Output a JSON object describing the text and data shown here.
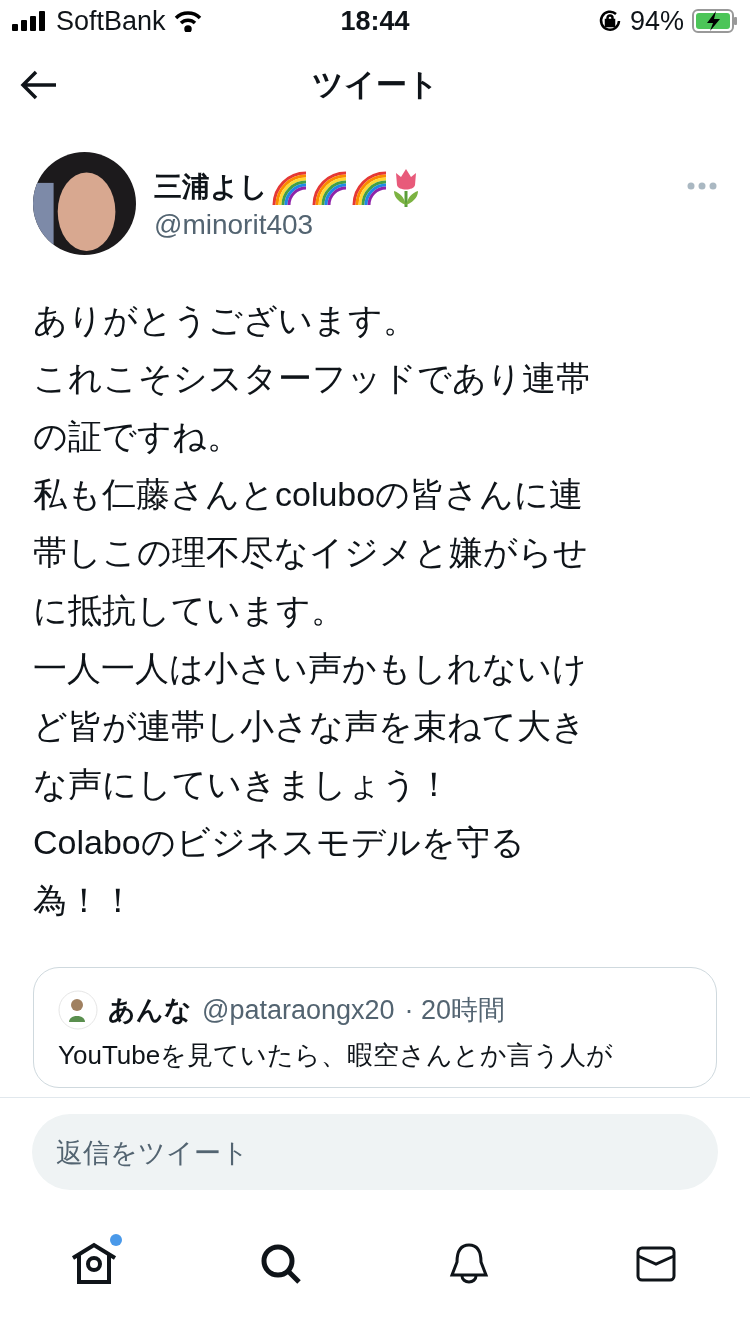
{
  "status_bar": {
    "carrier": "SoftBank",
    "time": "18:44",
    "battery": "94%"
  },
  "header": {
    "title": "ツイート"
  },
  "tweet": {
    "name": "三浦よし",
    "handle": "@minorit403",
    "lines": [
      "ありがとうございます。",
      "これこそシスターフッドであり連帯",
      "の証ですね。",
      "私も仁藤さんとcoluboの皆さんに連",
      "帯しこの理不尽なイジメと嫌がらせ",
      "に抵抗しています。",
      "一人一人は小さい声かもしれないけ",
      "ど皆が連帯し小さな声を束ねて大き",
      "な声にしていきましょう！",
      "Colaboのビジネスモデルを守る",
      "為！！"
    ],
    "quote": {
      "name": "あんな",
      "handle": "@pataraongx20",
      "time": "· 20時間",
      "text": "YouTubeを見ていたら、暇空さんとか言う人が"
    }
  },
  "reply": {
    "placeholder": "返信をツイート"
  },
  "tab_bar": [
    {
      "kind": "home",
      "selected": true,
      "badge": true
    },
    {
      "kind": "search",
      "selected": false,
      "badge": false
    },
    {
      "kind": "notifications",
      "selected": false,
      "badge": false
    },
    {
      "kind": "messages",
      "selected": false,
      "badge": false
    }
  ]
}
